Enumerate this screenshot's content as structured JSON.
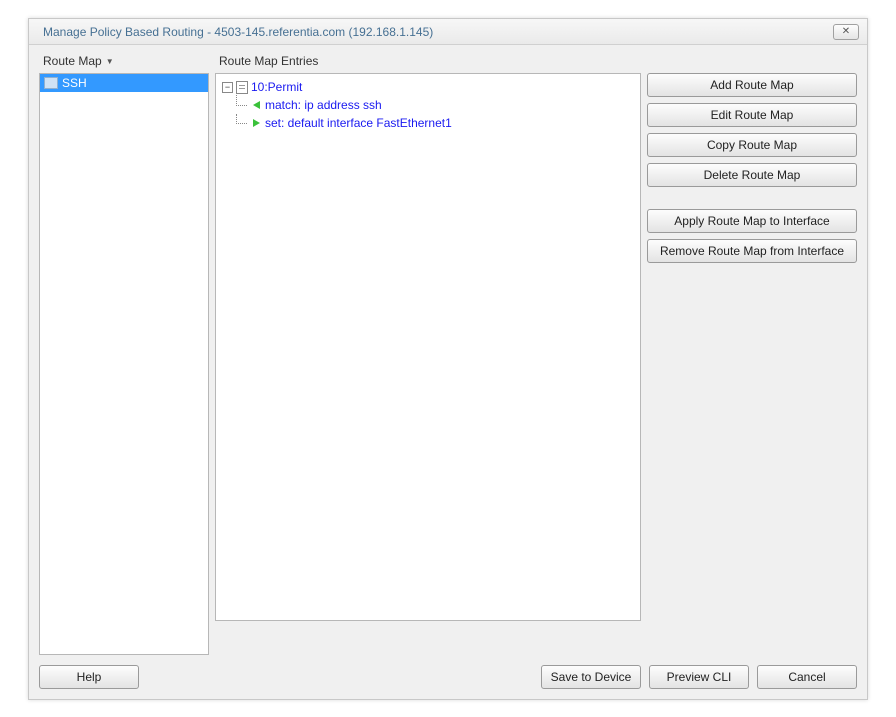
{
  "title": "Manage Policy Based Routing - 4503-145.referentia.com (192.168.1.145)",
  "close_glyph": "✕",
  "left": {
    "header": "Route Map",
    "items": [
      {
        "label": "SSH",
        "selected": true
      }
    ]
  },
  "middle": {
    "header": "Route Map Entries",
    "tree": {
      "root_label": "10:Permit",
      "children": [
        {
          "dir": "left",
          "label": "match: ip address ssh"
        },
        {
          "dir": "right",
          "label": "set: default interface FastEthernet1"
        }
      ]
    }
  },
  "right": {
    "buttons_group1": [
      "Add Route Map",
      "Edit Route Map",
      "Copy Route Map",
      "Delete Route Map"
    ],
    "buttons_group2": [
      "Apply Route Map to Interface",
      "Remove Route Map from Interface"
    ]
  },
  "bottom": {
    "help": "Help",
    "save": "Save to Device",
    "preview": "Preview CLI",
    "cancel": "Cancel"
  }
}
